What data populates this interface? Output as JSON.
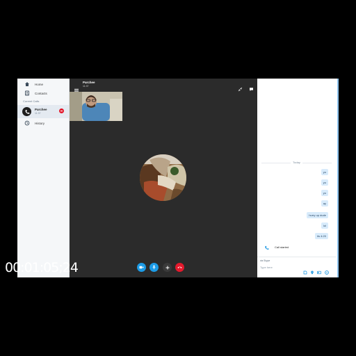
{
  "sidebar": {
    "nav": [
      {
        "label": "Home",
        "icon": "home-icon"
      },
      {
        "label": "Contacts",
        "icon": "contacts-icon"
      }
    ],
    "section_label": "Current Calls",
    "current_call": {
      "name": "Parchee",
      "time": "11:37"
    },
    "history_label": "History"
  },
  "call": {
    "contact_name": "Parchee",
    "duration": "11:37"
  },
  "chat": {
    "date_separator": "Today",
    "messages": [
      "yo",
      "yo",
      "yo",
      "ay",
      "hurry up dude",
      "lol",
      "its 4:20"
    ],
    "call_started": "Call started",
    "via_label": "via Skype",
    "input_placeholder": "Type here"
  },
  "overlay": {
    "timecode": "00:01:05;24"
  },
  "colors": {
    "accent": "#0a8fe0",
    "end_call": "#e3192c",
    "bubble": "#d8ebfb",
    "call_bg": "#2b2b2b"
  }
}
